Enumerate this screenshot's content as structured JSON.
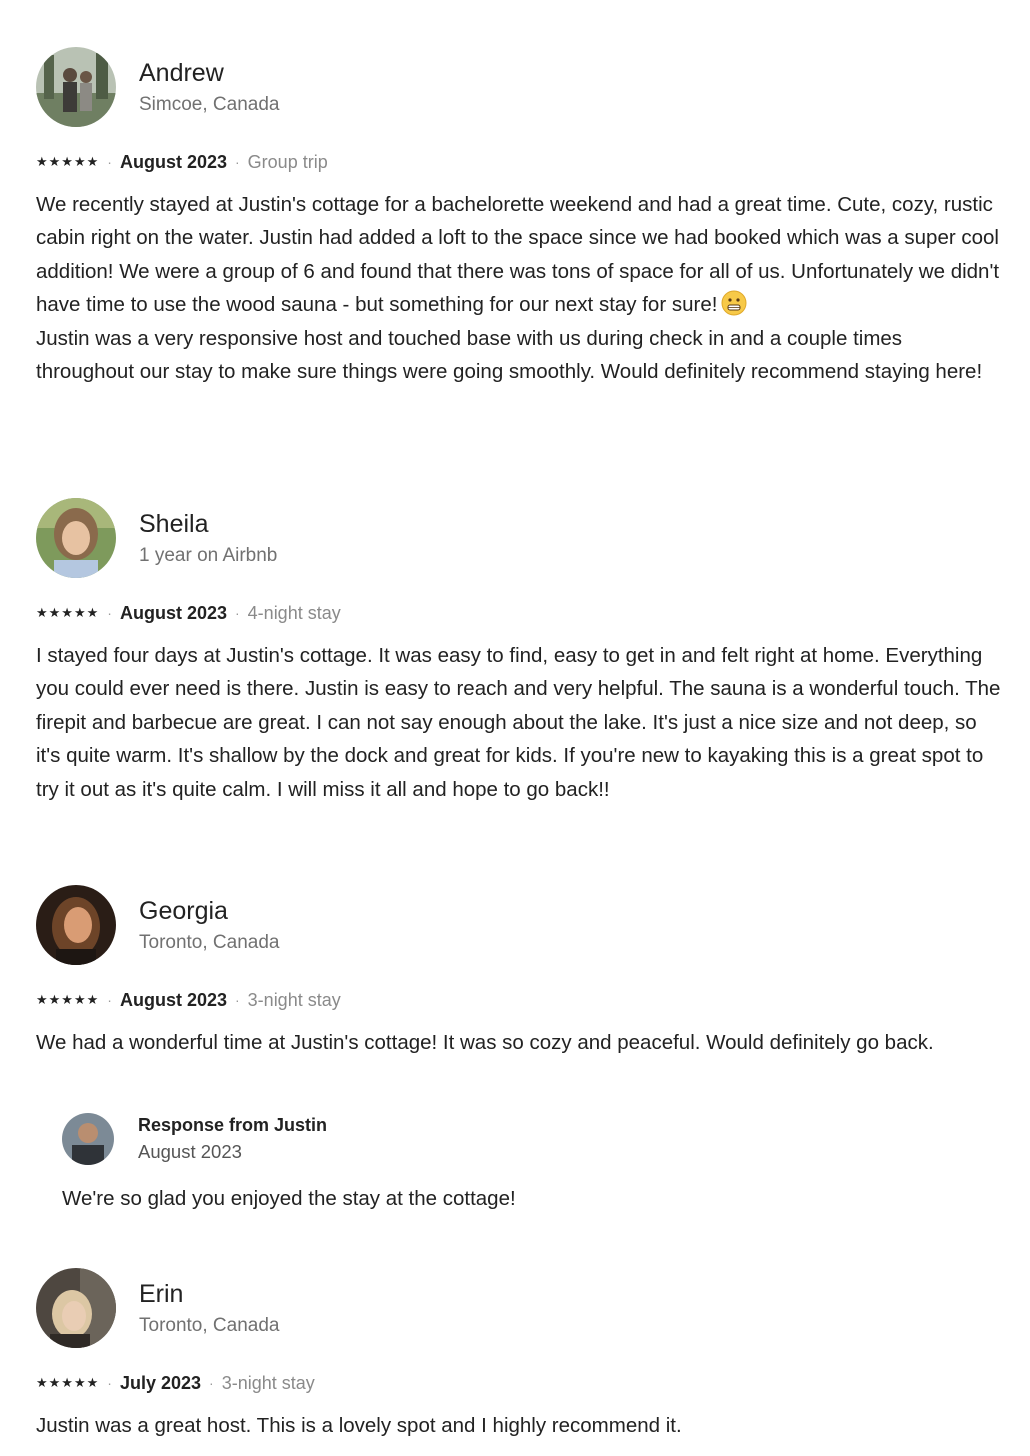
{
  "reviews": [
    {
      "name": "Andrew",
      "meta": "Simcoe, Canada",
      "stars": "★★★★★",
      "date": "August 2023",
      "stay": "Group trip",
      "text": "We recently stayed at Justin's cottage for a bachelorette weekend and had a great time. Cute, cozy, rustic cabin right on the water. Justin had added a loft to the space since we had booked which was a super cool addition! We were a group of 6 and found that there was tons of space for all of us. Unfortunately we didn't have time to use the wood sauna - but something for our next stay for sure!",
      "text_after": "Justin was a very responsive host and touched base with us during check in and a couple times throughout our stay to make sure things were going smoothly. Would definitely recommend staying here!",
      "emoji": "grimacing-face-emoji"
    },
    {
      "name": "Sheila",
      "meta": "1 year on Airbnb",
      "stars": "★★★★★",
      "date": "August 2023",
      "stay": "4-night stay",
      "text": "I stayed four days at Justin's cottage. It was easy to find, easy to get in and felt right at home. Everything you could ever need is there. Justin is easy to reach and very helpful. The sauna is a wonderful touch. The firepit and barbecue are great. I can not say enough about the lake. It's just a nice size and not deep, so it's quite warm. It's shallow by the dock and great for kids. If you're new to kayaking this is a great spot to try it out as it's quite calm. I will miss it all and hope to go back!!"
    },
    {
      "name": "Georgia",
      "meta": "Toronto, Canada",
      "stars": "★★★★★",
      "date": "August 2023",
      "stay": "3-night stay",
      "text": "We had a wonderful time at Justin's cottage! It was so cozy and peaceful. Would definitely go back."
    },
    {
      "name": "Erin",
      "meta": "Toronto, Canada",
      "stars": "★★★★★",
      "date": "July 2023",
      "stay": "3-night stay",
      "text": "Justin was a great host. This is a lovely spot and I highly recommend it."
    }
  ],
  "response": {
    "title": "Response from Justin",
    "date": "August 2023",
    "text": "We're so glad you enjoyed the stay at the cottage!"
  },
  "separator": "·",
  "colors": {
    "text": "#222222",
    "muted": "#717171",
    "background": "#ffffff"
  }
}
